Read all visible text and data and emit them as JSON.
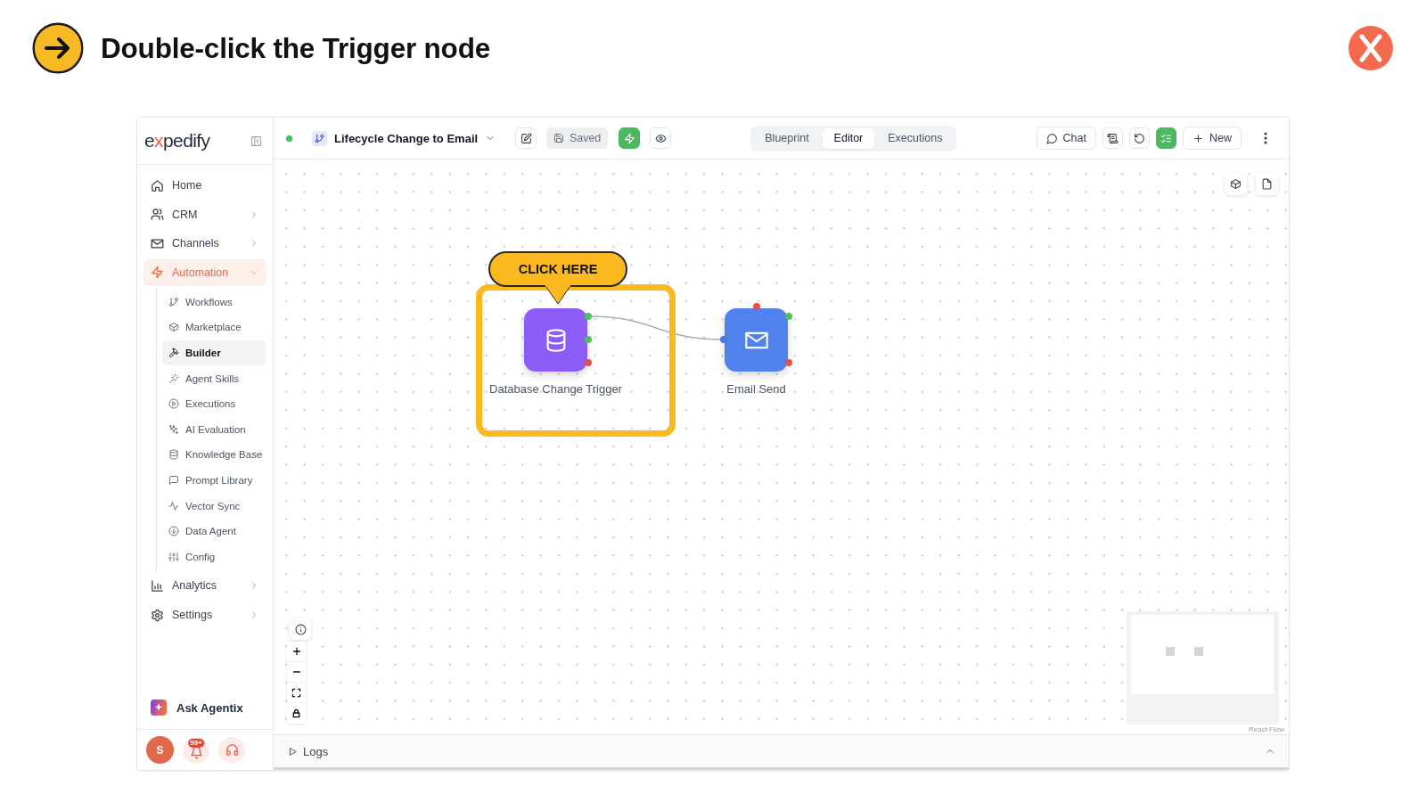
{
  "instruction": {
    "title": "Double-click the Trigger node"
  },
  "sidebar": {
    "logo": [
      {
        "text": "e",
        "accent": false
      },
      {
        "text": "x",
        "accent": true
      },
      {
        "text": "pedify",
        "accent": false
      }
    ],
    "items": [
      {
        "label": "Home",
        "selected": false
      },
      {
        "label": "CRM",
        "selected": false,
        "expanded": false
      },
      {
        "label": "Channels",
        "selected": false,
        "expanded": false
      },
      {
        "label": "Automation",
        "selected": true,
        "expanded": true,
        "children": [
          {
            "label": "Workflows",
            "selected": false
          },
          {
            "label": "Marketplace",
            "selected": false
          },
          {
            "label": "Builder",
            "selected": true
          },
          {
            "label": "Agent Skills",
            "selected": false
          },
          {
            "label": "Executions",
            "selected": false
          },
          {
            "label": "AI Evaluation",
            "selected": false
          },
          {
            "label": "Knowledge Base",
            "selected": false
          },
          {
            "label": "Prompt Library",
            "selected": false
          },
          {
            "label": "Vector Sync",
            "selected": false
          },
          {
            "label": "Data Agent",
            "selected": false
          },
          {
            "label": "Config",
            "selected": false
          }
        ]
      },
      {
        "label": "Analytics",
        "selected": false,
        "expanded": false
      },
      {
        "label": "Settings",
        "selected": false,
        "expanded": false
      }
    ],
    "assistant": {
      "label": "Ask Agentix"
    },
    "footer": {
      "avatar_initial": "S",
      "notification_count": "99+"
    }
  },
  "toolbar": {
    "workflow": {
      "active": true,
      "title": "Lifecycle Change to Email"
    },
    "save_status": {
      "label": "Saved",
      "disabled": true
    },
    "trigger_toggle": {
      "on": true
    },
    "view_tabs": [
      {
        "label": "Blueprint",
        "selected": false
      },
      {
        "label": "Editor",
        "selected": true
      },
      {
        "label": "Executions",
        "selected": false
      }
    ],
    "chat_button": {
      "label": "Chat"
    },
    "checklist_toggle": {
      "on": true
    },
    "new_button": {
      "label": "New"
    }
  },
  "canvas": {
    "callout": {
      "label": "CLICK HERE"
    },
    "nodes": [
      {
        "label": "Database Change Trigger",
        "kind": "trigger",
        "color": "#8b5cf6",
        "highlighted": true
      },
      {
        "label": "Email Send",
        "kind": "action",
        "color": "#4f82ec",
        "highlighted": false
      }
    ],
    "attribution": "React Flow"
  },
  "logs_panel": {
    "label": "Logs",
    "expanded": false
  }
}
